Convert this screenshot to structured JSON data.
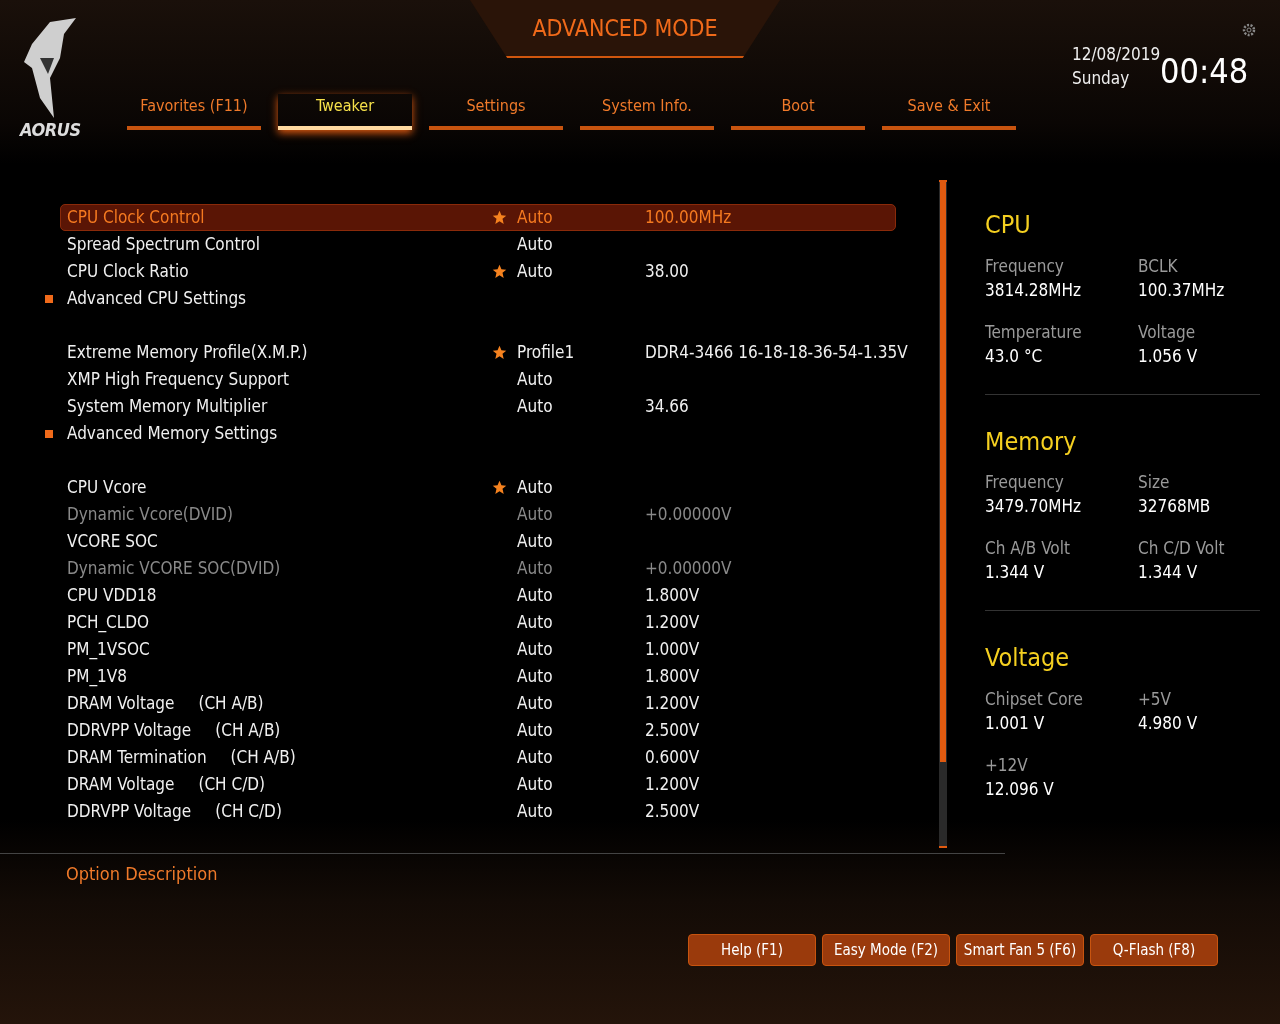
{
  "brand": {
    "logo_text": "AORUS"
  },
  "header": {
    "title": "ADVANCED MODE",
    "date": "12/08/2019",
    "weekday": "Sunday",
    "time": "00:48"
  },
  "tabs": [
    {
      "label": "Favorites (F11)",
      "selected": false
    },
    {
      "label": "Tweaker",
      "selected": true
    },
    {
      "label": "Settings",
      "selected": false
    },
    {
      "label": "System Info.",
      "selected": false
    },
    {
      "label": "Boot",
      "selected": false
    },
    {
      "label": "Save & Exit",
      "selected": false
    }
  ],
  "settings_groups": [
    [
      {
        "kind": "setting",
        "name": "CPU Clock Control",
        "value": "Auto",
        "value_2": "100.00MHz",
        "starred": true,
        "disabled": false,
        "selected": true
      },
      {
        "kind": "setting",
        "name": "Spread Spectrum Control",
        "value": "Auto",
        "starred": false,
        "disabled": false,
        "selected": false
      },
      {
        "kind": "setting",
        "name": "CPU Clock Ratio",
        "value": "Auto",
        "value_2": "38.00",
        "starred": true,
        "disabled": false,
        "selected": false
      },
      {
        "kind": "submenu",
        "name": "Advanced CPU Settings",
        "selected": false
      }
    ],
    [
      {
        "kind": "setting",
        "name": "Extreme Memory Profile(X.M.P.)",
        "value": "Profile1",
        "value_2": "DDR4-3466 16-18-18-36-54-1.35V",
        "starred": true,
        "disabled": false,
        "selected": false
      },
      {
        "kind": "setting",
        "name": "XMP High Frequency Support",
        "value": "Auto",
        "starred": false,
        "disabled": false,
        "selected": false
      },
      {
        "kind": "setting",
        "name": "System Memory Multiplier",
        "value": "Auto",
        "value_2": "34.66",
        "starred": false,
        "disabled": false,
        "selected": false
      },
      {
        "kind": "submenu",
        "name": "Advanced Memory Settings",
        "selected": false
      }
    ],
    [
      {
        "kind": "setting",
        "name": "CPU Vcore",
        "value": "Auto",
        "starred": true,
        "disabled": false,
        "selected": false
      },
      {
        "kind": "setting",
        "name": "Dynamic Vcore(DVID)",
        "value": "Auto",
        "value_2": "+0.00000V",
        "starred": false,
        "disabled": true,
        "selected": false
      },
      {
        "kind": "setting",
        "name": "VCORE SOC",
        "value": "Auto",
        "starred": false,
        "disabled": false,
        "selected": false
      },
      {
        "kind": "setting",
        "name": "Dynamic VCORE SOC(DVID)",
        "value": "Auto",
        "value_2": "+0.00000V",
        "starred": false,
        "disabled": true,
        "selected": false
      },
      {
        "kind": "setting",
        "name": "CPU VDD18",
        "value": "Auto",
        "value_2": "1.800V",
        "starred": false,
        "disabled": false,
        "selected": false
      },
      {
        "kind": "setting",
        "name": "PCH_CLDO",
        "value": "Auto",
        "value_2": "1.200V",
        "starred": false,
        "disabled": false,
        "selected": false
      },
      {
        "kind": "setting",
        "name": "PM_1VSOC",
        "value": "Auto",
        "value_2": "1.000V",
        "starred": false,
        "disabled": false,
        "selected": false
      },
      {
        "kind": "setting",
        "name": "PM_1V8",
        "value": "Auto",
        "value_2": "1.800V",
        "starred": false,
        "disabled": false,
        "selected": false
      },
      {
        "kind": "setting",
        "name": "DRAM Voltage",
        "channel": "(CH A/B)",
        "value": "Auto",
        "value_2": "1.200V",
        "starred": false,
        "disabled": false,
        "selected": false
      },
      {
        "kind": "setting",
        "name": "DDRVPP Voltage",
        "channel": "(CH A/B)",
        "value": "Auto",
        "value_2": "2.500V",
        "starred": false,
        "disabled": false,
        "selected": false
      },
      {
        "kind": "setting",
        "name": "DRAM Termination",
        "channel": "(CH A/B)",
        "value": "Auto",
        "value_2": "0.600V",
        "starred": false,
        "disabled": false,
        "selected": false
      },
      {
        "kind": "setting",
        "name": "DRAM Voltage",
        "channel": "(CH C/D)",
        "value": "Auto",
        "value_2": "1.200V",
        "starred": false,
        "disabled": false,
        "selected": false
      },
      {
        "kind": "setting",
        "name": "DDRVPP Voltage",
        "channel": "(CH C/D)",
        "value": "Auto",
        "value_2": "2.500V",
        "starred": false,
        "disabled": false,
        "selected": false
      }
    ]
  ],
  "monitor": [
    {
      "title": "CPU",
      "readings": [
        {
          "label": "Frequency",
          "value": "3814.28MHz"
        },
        {
          "label": "BCLK",
          "value": "100.37MHz"
        },
        {
          "label": "Temperature",
          "value": "43.0 °C"
        },
        {
          "label": "Voltage",
          "value": "1.056 V"
        }
      ]
    },
    {
      "title": "Memory",
      "readings": [
        {
          "label": "Frequency",
          "value": "3479.70MHz"
        },
        {
          "label": "Size",
          "value": "32768MB"
        },
        {
          "label": "Ch A/B Volt",
          "value": "1.344 V"
        },
        {
          "label": "Ch C/D Volt",
          "value": "1.344 V"
        }
      ]
    },
    {
      "title": "Voltage",
      "readings": [
        {
          "label": "Chipset Core",
          "value": "1.001 V"
        },
        {
          "label": "+5V",
          "value": "4.980 V"
        },
        {
          "label": "+12V",
          "value": "12.096 V"
        }
      ]
    }
  ],
  "description": {
    "title": "Option Description"
  },
  "buttons": [
    "Help (F1)",
    "Easy Mode (F2)",
    "Smart Fan 5 (F6)",
    "Q-Flash (F8)"
  ]
}
